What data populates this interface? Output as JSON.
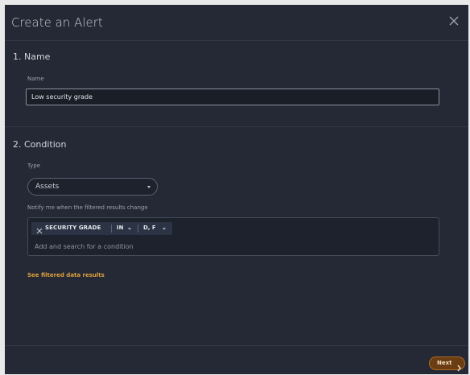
{
  "dialog": {
    "title": "Create an Alert",
    "close_icon": "close-icon"
  },
  "name_section": {
    "heading": "1. Name",
    "field_label": "Name",
    "value": "Low security grade"
  },
  "condition_section": {
    "heading": "2. Condition",
    "type_label": "Type",
    "type_value": "Assets",
    "notify_label": "Notify me when the filtered results change",
    "chip": {
      "remove_icon": "close-icon",
      "field": "SECURITY GRADE",
      "operator": "IN",
      "value": "D, F"
    },
    "input_placeholder": "Add and search for a condition",
    "see_results_link": "See filtered data results"
  },
  "footer": {
    "next_label": "Next",
    "next_icon": "chevron-right-icon"
  },
  "colors": {
    "modal_bg": "#242935",
    "accent": "#e0a13e",
    "next_button": "#6a3e12"
  }
}
